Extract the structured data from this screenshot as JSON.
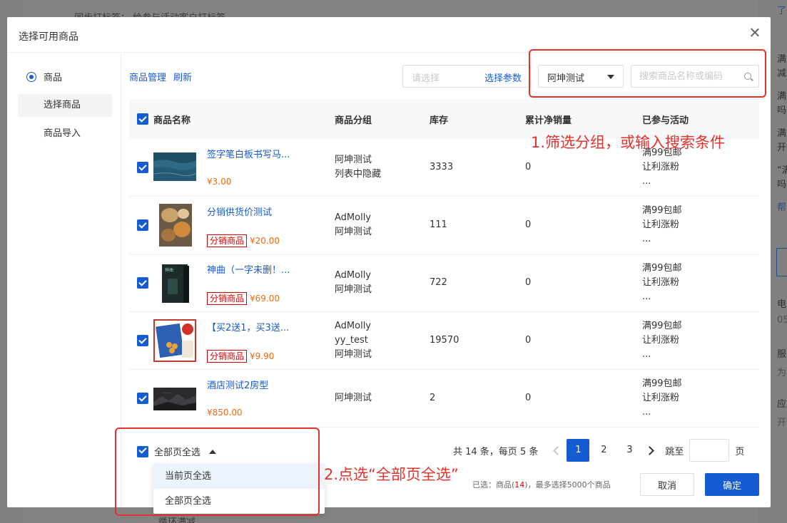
{
  "background": {
    "top_text": "同步打标签：  给参与活动客户打标签",
    "bottom_text": "循环满减",
    "right_texts": [
      "了",
      "满",
      "减",
      "满",
      "吗",
      "满",
      "开",
      "“满",
      "吗",
      "帮",
      "电",
      "05",
      "服",
      "为",
      "应",
      "开"
    ]
  },
  "dialog": {
    "title": "选择可用商品"
  },
  "left_nav": {
    "radio_label": "商品",
    "items": [
      "选择商品",
      "商品导入"
    ]
  },
  "toolbar": {
    "manage_link": "商品管理",
    "refresh_link": "刷新",
    "param_placeholder": "请选择",
    "param_button": "选择参数",
    "group_value": "阿坤测试",
    "search_placeholder": "搜索商品名称或编码"
  },
  "table": {
    "headers": [
      "商品名称",
      "商品分组",
      "库存",
      "累计净销量",
      "已参与活动"
    ],
    "rows": [
      {
        "name": "签字笔白板书写马...",
        "tag": "",
        "price": "¥3.00",
        "group": "阿坤测试\n列表中隐藏",
        "stock": "3333",
        "sales": "0",
        "activity": "满99包邮\n让利涨粉\n..."
      },
      {
        "name": "分销供货价测试",
        "tag": "分销商品",
        "price": "¥20.00",
        "group": "AdMolly\n阿坤测试",
        "stock": "111",
        "sales": "0",
        "activity": "满99包邮\n让利涨粉\n..."
      },
      {
        "name": "神曲（一字未删！...",
        "tag": "分销商品",
        "price": "¥69.00",
        "group": "AdMolly\n阿坤测试",
        "stock": "722",
        "sales": "0",
        "activity": "满99包邮\n让利涨粉\n..."
      },
      {
        "name": "【买2送1，买3送...",
        "tag": "分销商品",
        "price": "¥9.90",
        "group": "AdMolly\nyy_test\n阿坤测试",
        "stock": "19570",
        "sales": "0",
        "activity": "满99包邮\n让利涨粉\n..."
      },
      {
        "name": "酒店测试2房型",
        "tag": "",
        "price": "¥850.00",
        "group": "阿坤测试",
        "stock": "2",
        "sales": "0",
        "activity": "满99包邮\n让利涨粉\n..."
      }
    ]
  },
  "footer": {
    "select_all_label": "全部页全选",
    "dropdown": [
      "当前页全选",
      "全部页全选"
    ],
    "total_text": "共 14 条，每页 5 条",
    "pages": [
      "1",
      "2",
      "3"
    ],
    "current_page": "1",
    "jump_label": "跳至",
    "page_unit": "页",
    "selected_prefix": "已选：商品(",
    "selected_count": "14",
    "selected_suffix": ")，最多选择5000个商品",
    "cancel": "取消",
    "confirm": "确定"
  },
  "annotations": {
    "step1": "1.筛选分组，或输入搜索条件",
    "step2": "2.点选“全部页全选”",
    "color": "#e5312b"
  },
  "colors": {
    "primary": "#155bd4",
    "price": "#ed6a0c",
    "tag": "#d40000"
  }
}
